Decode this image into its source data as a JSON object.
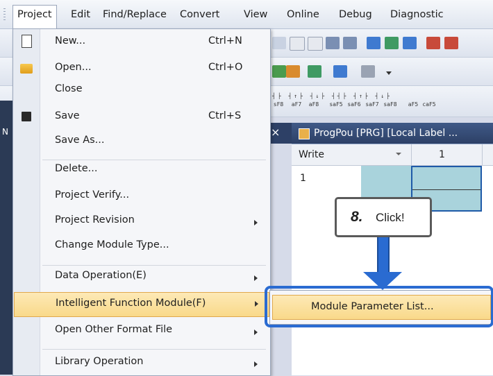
{
  "menubar": {
    "items": [
      "Project",
      "Edit",
      "Find/Replace",
      "Convert",
      "View",
      "Online",
      "Debug",
      "Diagnostic"
    ]
  },
  "toolbar": {
    "row3_labels": [
      "sF8",
      "aF7",
      "aF8",
      "saF5",
      "saF6",
      "saF7",
      "saF8",
      "aF5",
      "caF5"
    ]
  },
  "left_panel_label": "N",
  "editor": {
    "tab_title": "ProgPou [PRG] [Local Label ...",
    "tab_close": "×",
    "grid_header_write": "Write",
    "grid_header_col": "1",
    "grid_row_num": "1"
  },
  "project_menu": {
    "items": [
      {
        "label": "New...",
        "shortcut": "Ctrl+N",
        "icon": "new-file-icon"
      },
      {
        "label": "Open...",
        "shortcut": "Ctrl+O",
        "icon": "open-folder-icon"
      },
      {
        "label": "Close",
        "shortcut": ""
      },
      {
        "label": "Save",
        "shortcut": "Ctrl+S",
        "icon": "save-disk-icon"
      },
      {
        "label": "Save As...",
        "shortcut": ""
      },
      {
        "label": "Delete...",
        "shortcut": ""
      },
      {
        "label": "Project Verify...",
        "shortcut": ""
      },
      {
        "label": "Project Revision",
        "shortcut": "",
        "submenu": true
      },
      {
        "label": "Change Module Type...",
        "shortcut": ""
      },
      {
        "label": "Data Operation(E)",
        "shortcut": "",
        "submenu": true
      },
      {
        "label": "Intelligent Function Module(F)",
        "shortcut": "",
        "submenu": true,
        "highlighted": true
      },
      {
        "label": "Open Other Format File",
        "shortcut": "",
        "submenu": true
      },
      {
        "label": "Library Operation",
        "shortcut": "",
        "submenu": true
      }
    ]
  },
  "submenu": {
    "item": "Module Parameter List..."
  },
  "callout": {
    "step": "8.",
    "text": "Click!"
  },
  "colors": {
    "highlight": "#f9d98a",
    "annotation_blue": "#2a6bd1"
  }
}
